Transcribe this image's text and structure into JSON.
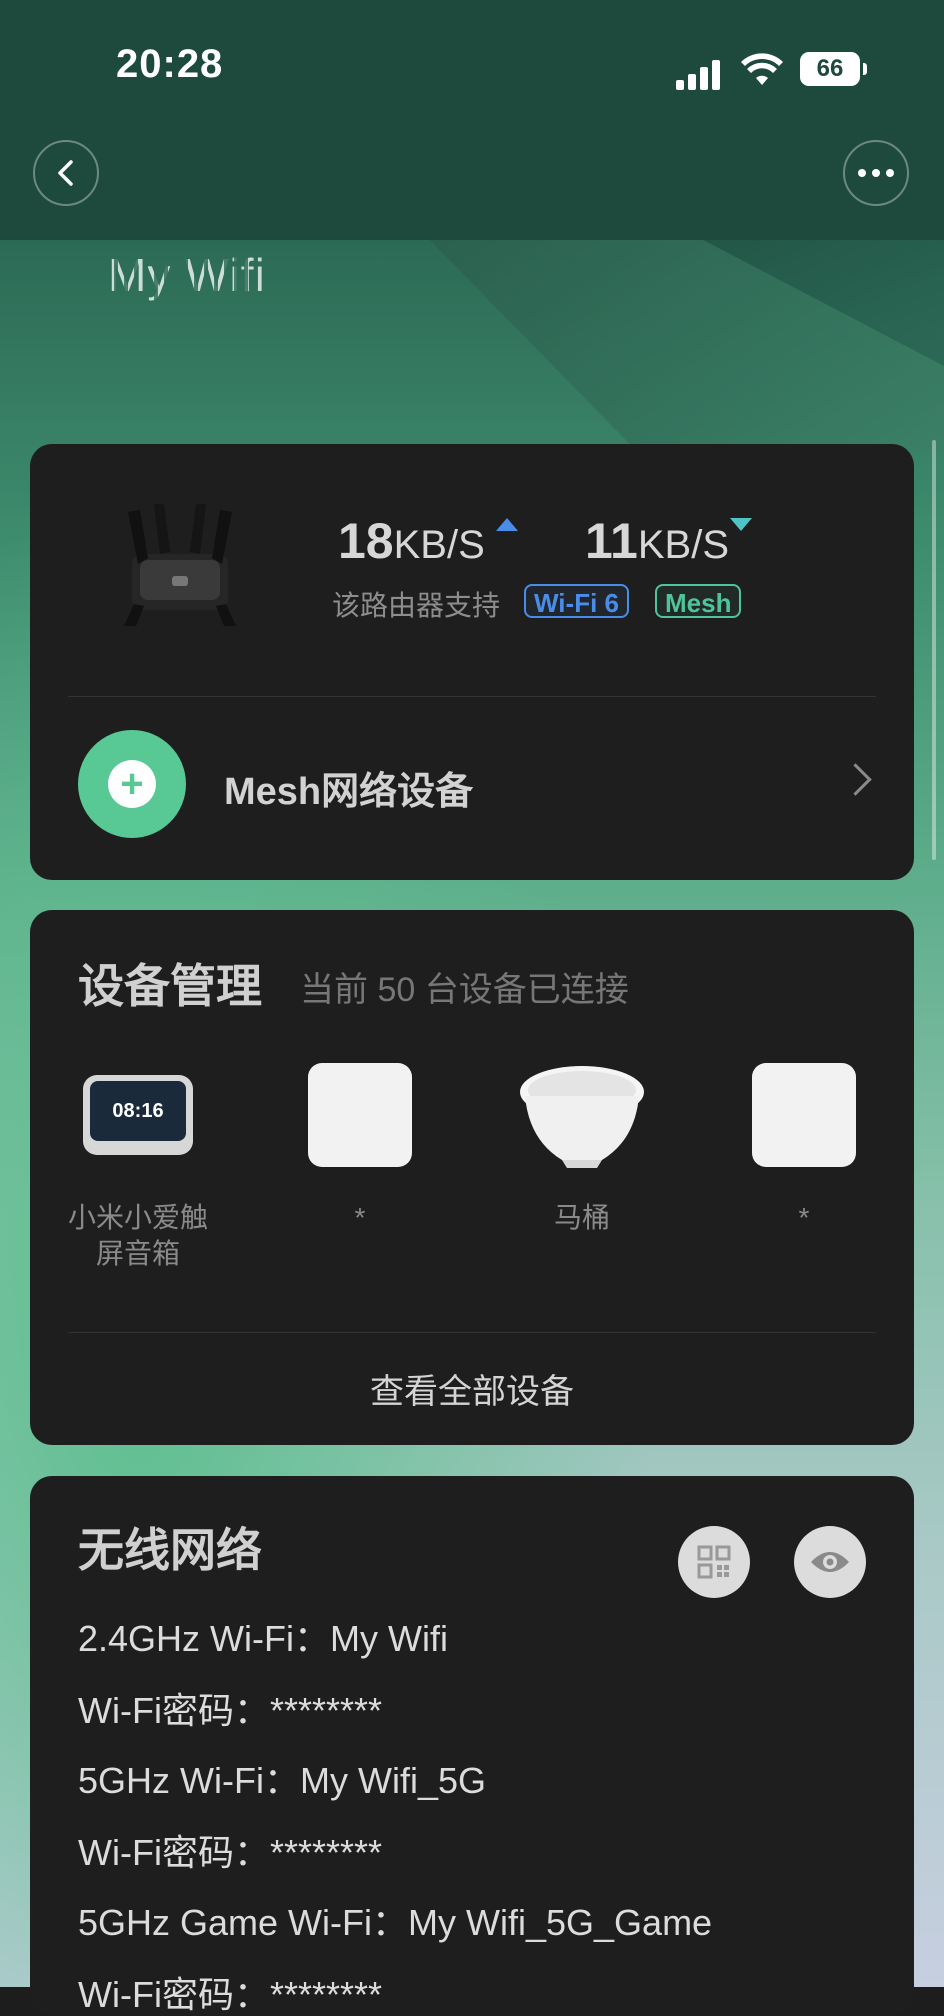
{
  "status_bar": {
    "time": "20:28",
    "battery": "66"
  },
  "header": {
    "title": "My Wifi"
  },
  "router": {
    "upload_value": "18",
    "upload_unit": "KB/S",
    "download_value": "11",
    "download_unit": "KB/S",
    "support_text": "该路由器支持",
    "badges": [
      "Wi-Fi 6",
      "Mesh"
    ],
    "mesh_label": "Mesh网络设备"
  },
  "devices": {
    "title": "设备管理",
    "subtitle": "当前 50 台设备已连接",
    "speaker_clock": "08:16",
    "items": [
      {
        "name_line1": "小米小爱触",
        "name_line2": "屏音箱"
      },
      {
        "name_line1": "*",
        "name_line2": ""
      },
      {
        "name_line1": "马桶",
        "name_line2": ""
      },
      {
        "name_line1": "*",
        "name_line2": ""
      }
    ],
    "view_all": "查看全部设备"
  },
  "wireless": {
    "title": "无线网络",
    "lines": [
      "2.4GHz Wi-Fi：My Wifi",
      "Wi-Fi密码：********",
      "5GHz Wi-Fi：My Wifi_5G",
      "Wi-Fi密码：********",
      "5GHz Game Wi-Fi：My Wifi_5G_Game",
      "Wi-Fi密码：********"
    ]
  },
  "colors": {
    "accent_green": "#58c895",
    "wifi6_blue": "#4a8de8",
    "mesh_green": "#4fc49a"
  }
}
